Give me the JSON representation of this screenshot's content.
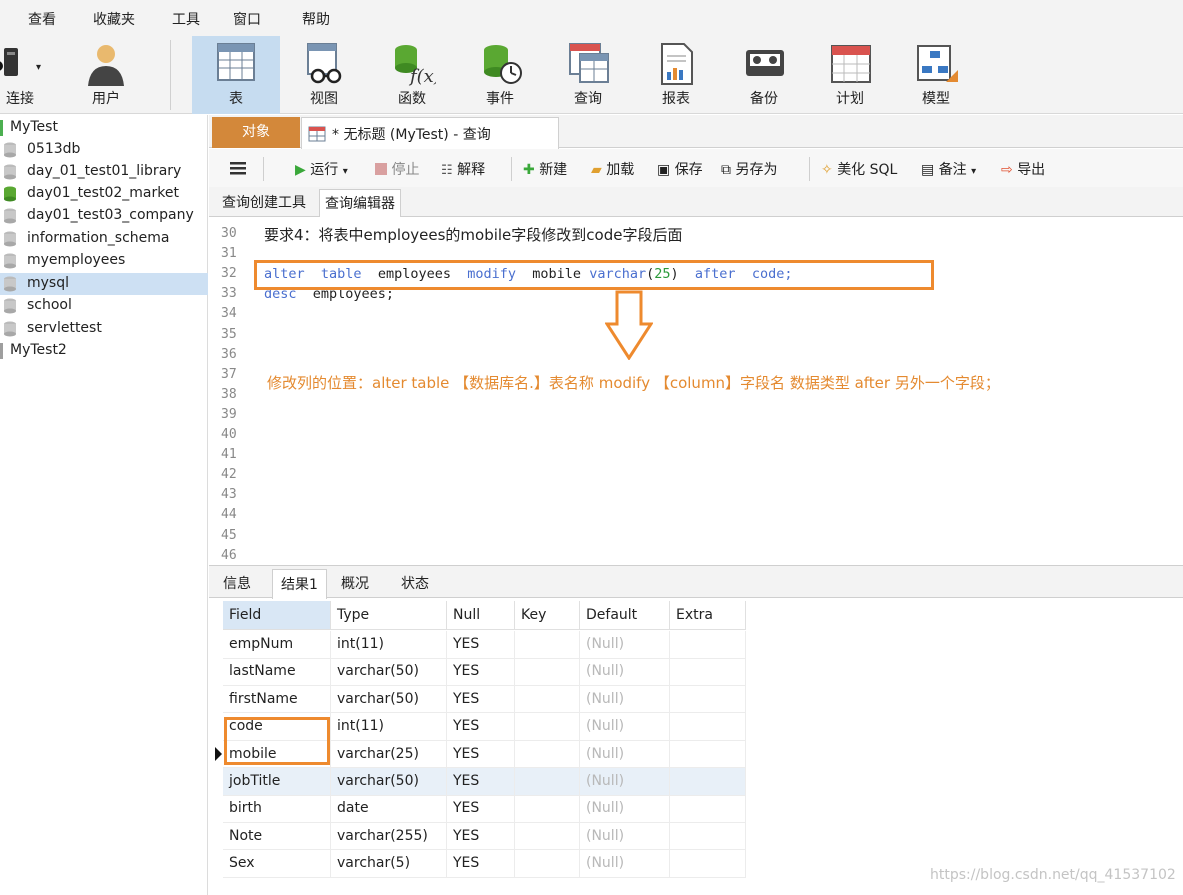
{
  "menu": [
    "查看",
    "收藏夹",
    "工具",
    "窗口",
    "帮助"
  ],
  "ribbon": {
    "connect": "连接",
    "user": "用户",
    "buttons": [
      "表",
      "视图",
      "函数",
      "事件",
      "查询",
      "报表",
      "备份",
      "计划",
      "模型"
    ]
  },
  "sidebar": {
    "connection_1": "MyTest",
    "databases": [
      "0513db",
      "day_01_test01_library",
      "day01_test02_market",
      "day01_test03_company",
      "information_schema",
      "myemployees",
      "mysql",
      "school",
      "servlettest"
    ],
    "connection_2": "MyTest2"
  },
  "tabs": {
    "objects": "对象",
    "query": "* 无标题 (MyTest) - 查询"
  },
  "toolbar": {
    "menu_icon": "hamburger-icon",
    "run": "运行",
    "stop": "停止",
    "explain": "解释",
    "new": "新建",
    "load": "加载",
    "save": "保存",
    "save_as": "另存为",
    "beautify": "美化 SQL",
    "notes": "备注",
    "export": "导出"
  },
  "subtabs": [
    "查询创建工具",
    "查询编辑器"
  ],
  "editor": {
    "line_numbers": [
      "30",
      "31",
      "32",
      "33",
      "34",
      "35",
      "36",
      "37",
      "38",
      "39",
      "40",
      "41",
      "42",
      "43",
      "44",
      "45",
      "46"
    ],
    "comment_line": "要求4：将表中employees的mobile字段修改到code字段后面",
    "line32": {
      "alter": "alter",
      "table": "table",
      "t1": "employees",
      "modify": "modify",
      "t2": "mobile",
      "varchar": "varchar",
      "open": "(",
      "n25": "25",
      "close": ")",
      "after": "after",
      "t3": "code;"
    },
    "line33": {
      "desc": "desc",
      "t1": "employees;"
    },
    "annotation": "修改列的位置：alter  table 【数据库名.】表名称  modify  【column】字段名  数据类型   after  另外一个字段；"
  },
  "bottom_tabs": [
    "信息",
    "结果1",
    "概况",
    "状态"
  ],
  "result": {
    "columns": [
      "Field",
      "Type",
      "Null",
      "Key",
      "Default",
      "Extra"
    ],
    "rows": [
      [
        "empNum",
        "int(11)",
        "YES",
        "",
        "(Null)",
        ""
      ],
      [
        "lastName",
        "varchar(50)",
        "YES",
        "",
        "(Null)",
        ""
      ],
      [
        "firstName",
        "varchar(50)",
        "YES",
        "",
        "(Null)",
        ""
      ],
      [
        "code",
        "int(11)",
        "YES",
        "",
        "(Null)",
        ""
      ],
      [
        "mobile",
        "varchar(25)",
        "YES",
        "",
        "(Null)",
        ""
      ],
      [
        "jobTitle",
        "varchar(50)",
        "YES",
        "",
        "(Null)",
        ""
      ],
      [
        "birth",
        "date",
        "YES",
        "",
        "(Null)",
        ""
      ],
      [
        "Note",
        "varchar(255)",
        "YES",
        "",
        "(Null)",
        ""
      ],
      [
        "Sex",
        "varchar(5)",
        "YES",
        "",
        "(Null)",
        ""
      ]
    ]
  },
  "watermark": "https://blog.csdn.net/qq_41537102",
  "colors": {
    "accent_orange": "#ee8a2e",
    "objects_tab": "#d3883a",
    "keyword_blue": "#4a6fcf",
    "number_green": "#2a9a3a",
    "selection": "#cde0f3"
  }
}
